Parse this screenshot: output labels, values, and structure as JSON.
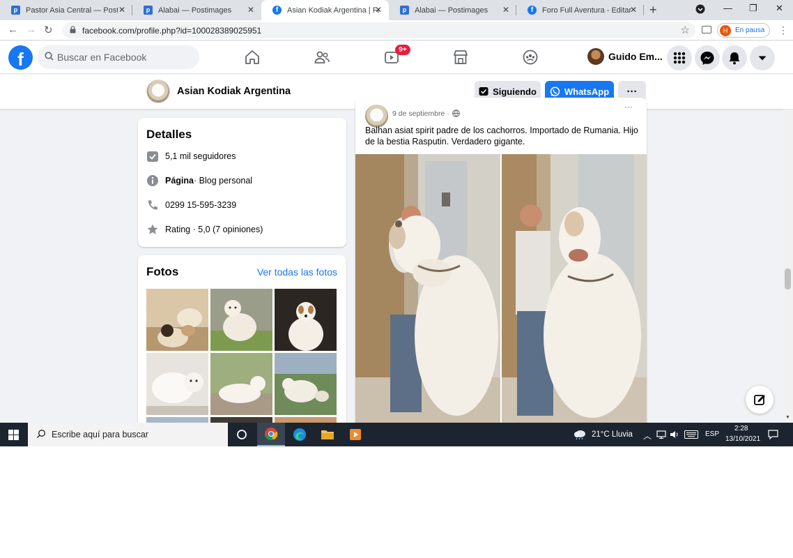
{
  "browser": {
    "tabs": [
      {
        "label": "Pastor Asia Central — Postim",
        "favicon": "postimages-favicon",
        "active": false
      },
      {
        "label": "Alabai — Postimages",
        "favicon": "postimages-favicon",
        "active": false
      },
      {
        "label": "Asian Kodiak Argentina | Face",
        "favicon": "facebook-favicon",
        "active": true
      },
      {
        "label": "Alabai — Postimages",
        "favicon": "postimages-favicon",
        "active": false
      },
      {
        "label": "Foro Full Aventura - Editar m",
        "favicon": "facebook-favicon",
        "active": false
      }
    ],
    "url": "facebook.com/profile.php?id=100028389025951",
    "profile_initial": "H",
    "profile_status": "En pausa"
  },
  "fbnav": {
    "search_placeholder": "Buscar en Facebook",
    "watch_badge": "9+",
    "user_name": "Guido Em..."
  },
  "page": {
    "name": "Asian Kodiak Argentina",
    "follow_label": "Siguiendo",
    "whatsapp_label": "WhatsApp",
    "more_label": "···"
  },
  "details": {
    "title": "Detalles",
    "followers": "5,1 mil seguidores",
    "category_bold": "Página",
    "category_rest": " · Blog personal",
    "phone": "0299 15-595-3239",
    "rating": "Rating · 5,0 (7 opiniones)"
  },
  "photos": {
    "title": "Fotos",
    "see_all": "Ver todas las fotos"
  },
  "post": {
    "date": "9 de septiembre ·",
    "text": "Balhan asiat spirit padre de los cachorros. Importado de Rumania. Hijo de la bestia Rasputin. Verdadero gigante."
  },
  "taskbar": {
    "search_placeholder": "Escribe aquí para buscar",
    "weather": "21°C  Lluvia",
    "lang": "ESP",
    "time": "2:28",
    "date": "13/10/2021"
  },
  "colors": {
    "facebook_blue": "#1877f2",
    "badge_red": "#e41e3f",
    "taskbar": "#1c2430"
  }
}
